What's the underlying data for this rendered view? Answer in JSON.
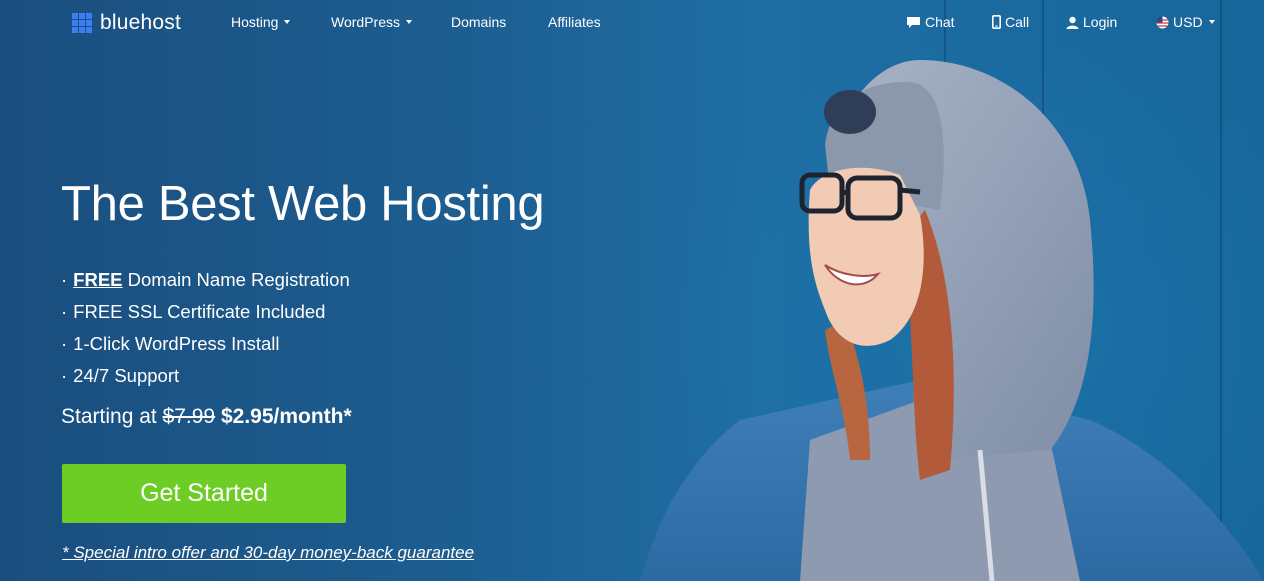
{
  "brand": {
    "name": "bluehost",
    "accent": "#3b7ff5"
  },
  "nav": {
    "items": [
      {
        "label": "Hosting",
        "has_dropdown": true
      },
      {
        "label": "WordPress",
        "has_dropdown": true
      },
      {
        "label": "Domains",
        "has_dropdown": false
      },
      {
        "label": "Affiliates",
        "has_dropdown": false
      }
    ],
    "utility": [
      {
        "label": "Chat",
        "icon": "chat-bubble-icon"
      },
      {
        "label": "Call",
        "icon": "phone-icon"
      },
      {
        "label": "Login",
        "icon": "user-icon"
      },
      {
        "label": "USD",
        "icon": "us-flag-icon",
        "has_dropdown": true
      }
    ]
  },
  "hero": {
    "headline": "The Best Web Hosting",
    "features": [
      {
        "bullet": "·",
        "strong": "FREE",
        "text": " Domain Name Registration"
      },
      {
        "bullet": "·",
        "text": "FREE SSL Certificate Included"
      },
      {
        "bullet": "·",
        "text": "1-Click WordPress Install"
      },
      {
        "bullet": "·",
        "text": "24/7 Support"
      }
    ],
    "pricing": {
      "prefix": "Starting at ",
      "old_price": "$7.99",
      "new_price": "$2.95/month*"
    },
    "cta_label": "Get Started",
    "offer_note": "* Special intro offer and 30-day money-back guarantee"
  },
  "colors": {
    "background": "#1d5f93",
    "cta": "#6dcd24",
    "text": "#ffffff"
  }
}
